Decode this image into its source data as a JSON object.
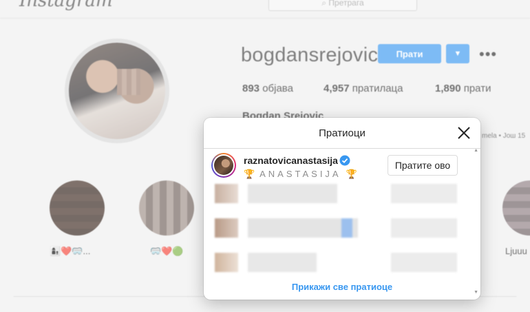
{
  "app": {
    "logo_text": "Instagram",
    "search_placeholder": "Претрага"
  },
  "profile": {
    "username": "bogdansrejovic",
    "follow_label": "Прати",
    "more_icon": "more-horizontal-icon",
    "stats": {
      "posts_count": "893",
      "posts_label": "објава",
      "followers_count": "4,957",
      "followers_label": "пратилаца",
      "following_count": "1,890",
      "following_label": "прати"
    },
    "full_name": "Bogdan Srejovic",
    "followed_by_fragment": "mela • Још 15"
  },
  "highlights": [
    {
      "label": "👩‍👦❤️🥽..."
    },
    {
      "label": "🥽❤️🟢"
    },
    {
      "label": "Ljuuu"
    }
  ],
  "modal": {
    "title": "Пратиоци",
    "close_icon": "close-icon",
    "followers": [
      {
        "username": "raznatovicanastasija",
        "verified": true,
        "subtitle_deco": "🏆",
        "subtitle": "ANASTASIJA",
        "button_label": "Пратите ово"
      }
    ],
    "show_all_label": "Прикажи све пратиоце"
  },
  "colors": {
    "accent_blue": "#3897f0",
    "verified_blue": "#3897f0",
    "text_primary": "#262626",
    "text_secondary": "#8e8e8e"
  }
}
